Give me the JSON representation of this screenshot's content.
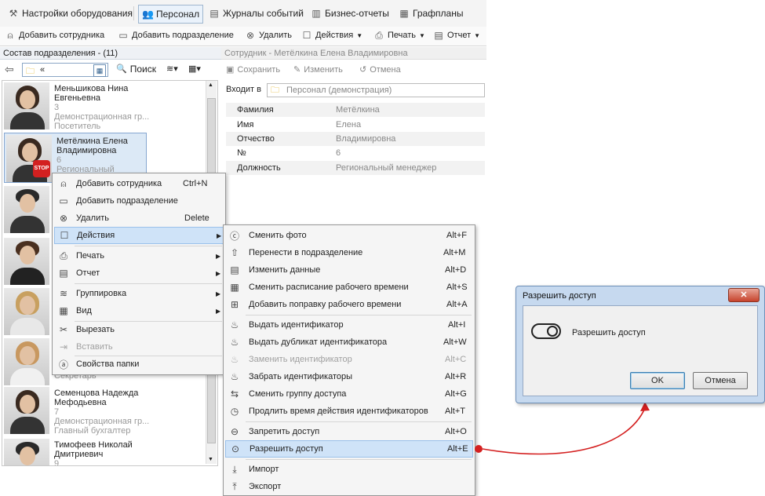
{
  "nav": {
    "items": [
      {
        "label": "Настройки оборудования",
        "icon": "tools-icon"
      },
      {
        "label": "Персонал",
        "icon": "people-icon",
        "active": true
      },
      {
        "label": "Журналы событий",
        "icon": "journal-icon"
      },
      {
        "label": "Бизнес-отчеты",
        "icon": "chart-icon"
      },
      {
        "label": "Графпланы",
        "icon": "building-icon"
      }
    ]
  },
  "toolbar": {
    "add_employee": "Добавить сотрудника",
    "add_department": "Добавить подразделение",
    "delete": "Удалить",
    "actions": "Действия",
    "print": "Печать",
    "report": "Отчет"
  },
  "left": {
    "header": "Состав подразделения - (11)",
    "combo_value": "«",
    "search": "Поиск",
    "persons": [
      {
        "name1": "Меньшикова Нина",
        "name2": "Евгеньевна",
        "num": "3",
        "group": "Демонстрационная гр...",
        "role": "Посетитель"
      },
      {
        "name1": "Метёлкина Елена",
        "name2": "Владимировна",
        "num": "6",
        "group": "",
        "role": "Региональный менедж..."
      },
      {
        "name1": "",
        "name2": "",
        "num": "",
        "group": "",
        "role": ""
      },
      {
        "name1": "",
        "name2": "",
        "num": "",
        "group": "",
        "role": ""
      },
      {
        "name1": "",
        "name2": "",
        "num": "",
        "group": "",
        "role": ""
      },
      {
        "name1": "",
        "name2": "",
        "num": "",
        "group": "",
        "role": "Секретарь"
      },
      {
        "name1": "Семенцова Надежда",
        "name2": "Мефодьевна",
        "num": "7",
        "group": "Демонстрационная гр...",
        "role": "Главный бухгалтер"
      },
      {
        "name1": "Тимофеев Николай",
        "name2": "Дмитриевич",
        "num": "9",
        "group": "",
        "role": ""
      }
    ]
  },
  "right": {
    "header": "Сотрудник - Метёлкина Елена Владимировна",
    "save": "Сохранить",
    "edit": "Изменить",
    "cancel": "Отмена",
    "member_of_label": "Входит в",
    "member_of_value": "Персонал (демонстрация)",
    "fields": [
      {
        "label": "Фамилия",
        "value": "Метёлкина"
      },
      {
        "label": "Имя",
        "value": "Елена"
      },
      {
        "label": "Отчество",
        "value": "Владимировна"
      },
      {
        "label": "№",
        "value": "6"
      },
      {
        "label": "Должность",
        "value": "Региональный менеджер"
      }
    ]
  },
  "context_menu": {
    "items": [
      {
        "label": "Добавить сотрудника",
        "shortcut": "Ctrl+N",
        "icon": "person-add-icon"
      },
      {
        "label": "Добавить подразделение",
        "shortcut": "",
        "icon": "folder-add-icon"
      },
      {
        "label": "Удалить",
        "shortcut": "Delete",
        "icon": "delete-icon"
      },
      {
        "label": "Действия",
        "shortcut": "",
        "icon": "actions-icon",
        "submenu": true
      },
      {
        "label": "Печать",
        "shortcut": "",
        "icon": "print-icon",
        "submenu": true
      },
      {
        "label": "Отчет",
        "shortcut": "",
        "icon": "report-icon",
        "submenu": true
      },
      {
        "label": "Группировка",
        "shortcut": "",
        "icon": "layers-icon",
        "submenu": true
      },
      {
        "label": "Вид",
        "shortcut": "",
        "icon": "grid-icon",
        "submenu": true
      },
      {
        "label": "Вырезать",
        "shortcut": "",
        "icon": "scissors-icon"
      },
      {
        "label": "Вставить",
        "shortcut": "",
        "icon": "paste-icon"
      },
      {
        "label": "Свойства папки",
        "shortcut": "",
        "icon": "properties-icon"
      }
    ]
  },
  "submenu": {
    "items": [
      {
        "label": "Сменить фото",
        "shortcut": "Alt+F"
      },
      {
        "label": "Перенести в подразделение",
        "shortcut": "Alt+M"
      },
      {
        "label": "Изменить данные",
        "shortcut": "Alt+D"
      },
      {
        "label": "Сменить расписание рабочего времени",
        "shortcut": "Alt+S"
      },
      {
        "label": "Добавить поправку рабочего времени",
        "shortcut": "Alt+A"
      },
      {
        "label": "Выдать идентификатор",
        "shortcut": "Alt+I"
      },
      {
        "label": "Выдать дубликат идентификатора",
        "shortcut": "Alt+W"
      },
      {
        "label": "Заменить идентификатор",
        "shortcut": "Alt+C"
      },
      {
        "label": "Забрать идентификаторы",
        "shortcut": "Alt+R"
      },
      {
        "label": "Сменить группу доступа",
        "shortcut": "Alt+G"
      },
      {
        "label": "Продлить время действия идентификаторов",
        "shortcut": "Alt+T"
      },
      {
        "label": "Запретить доступ",
        "shortcut": "Alt+O"
      },
      {
        "label": "Разрешить доступ",
        "shortcut": "Alt+E"
      },
      {
        "label": "Импорт",
        "shortcut": ""
      },
      {
        "label": "Экспорт",
        "shortcut": ""
      }
    ]
  },
  "dialog": {
    "title": "Разрешить доступ",
    "close": "✕",
    "toggle_label": "Разрешить доступ",
    "ok": "OK",
    "cancel": "Отмена"
  },
  "colors": {
    "accent": "#cfe3f8",
    "close": "#c7432c",
    "arrow": "#d42020"
  }
}
